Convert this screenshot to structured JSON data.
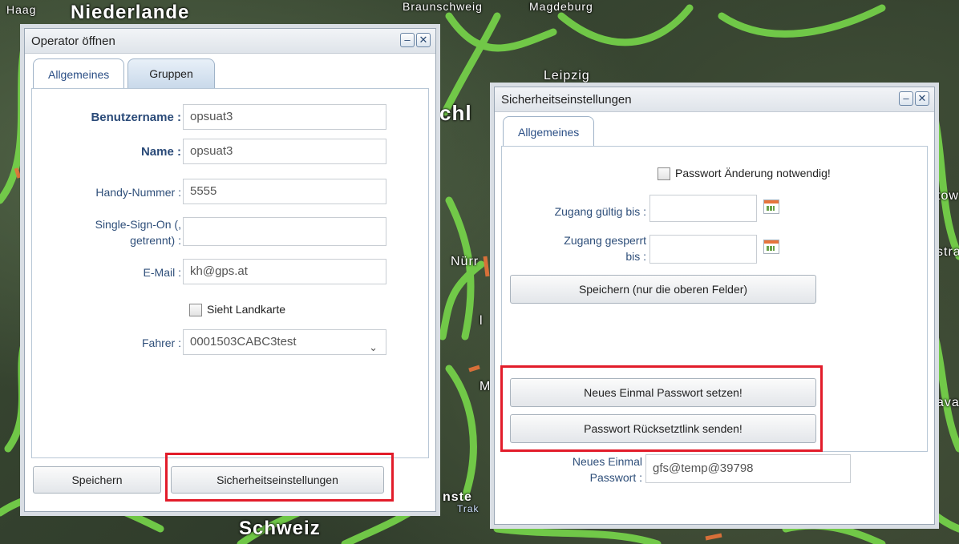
{
  "map": {
    "labels": {
      "haag": "Haag",
      "niederlande": "Niederlande",
      "braunschweig": "Braunschweig",
      "magdeburg": "Magdeburg",
      "leipzig": "Leipzig",
      "ch": "chl",
      "nurn": "Nürr",
      "schweiz": "Schweiz",
      "nste": "nste",
      "trak": "Trak",
      "tow": "tow",
      "stra": "stra",
      "ava": "ava",
      "m": "M",
      "l": "l"
    }
  },
  "operator_window": {
    "title": "Operator öffnen",
    "tabs": [
      "Allgemeines",
      "Gruppen"
    ],
    "fields": {
      "username_label": "Benutzername :",
      "username_value": "opsuat3",
      "name_label": "Name :",
      "name_value": "opsuat3",
      "phone_label": "Handy-Nummer :",
      "phone_value": "5555",
      "sso_label_line1": "Single-Sign-On (,",
      "sso_label_line2": "getrennt) :",
      "sso_value": "",
      "email_label": "E-Mail :",
      "email_value": "kh@gps.at",
      "map_checkbox_label": "Sieht Landkarte",
      "driver_label": "Fahrer :",
      "driver_value": "0001503CABC3test"
    },
    "buttons": {
      "save": "Speichern",
      "security": "Sicherheitseinstellungen"
    }
  },
  "security_window": {
    "title": "Sicherheitseinstellungen",
    "tabs": [
      "Allgemeines"
    ],
    "password_change_label": "Passwort Änderung notwendig!",
    "valid_until_label": "Zugang gültig bis :",
    "locked_until_line1": "Zugang gesperrt",
    "locked_until_line2": "bis :",
    "save_top_fields": "Speichern (nur die oberen Felder)",
    "set_otp": "Neues Einmal Passwort setzen!",
    "send_reset_link": "Passwort Rücksetztlink senden!",
    "otp_label_line1": "Neues Einmal",
    "otp_label_line2": "Passwort :",
    "otp_value": "gfs@temp@39798"
  },
  "window_controls": {
    "minimize": "–",
    "close": "✕"
  },
  "colors": {
    "highlight": "#e21c2a",
    "label_blue": "#2a4a78",
    "road_green": "#7fdc4a"
  }
}
